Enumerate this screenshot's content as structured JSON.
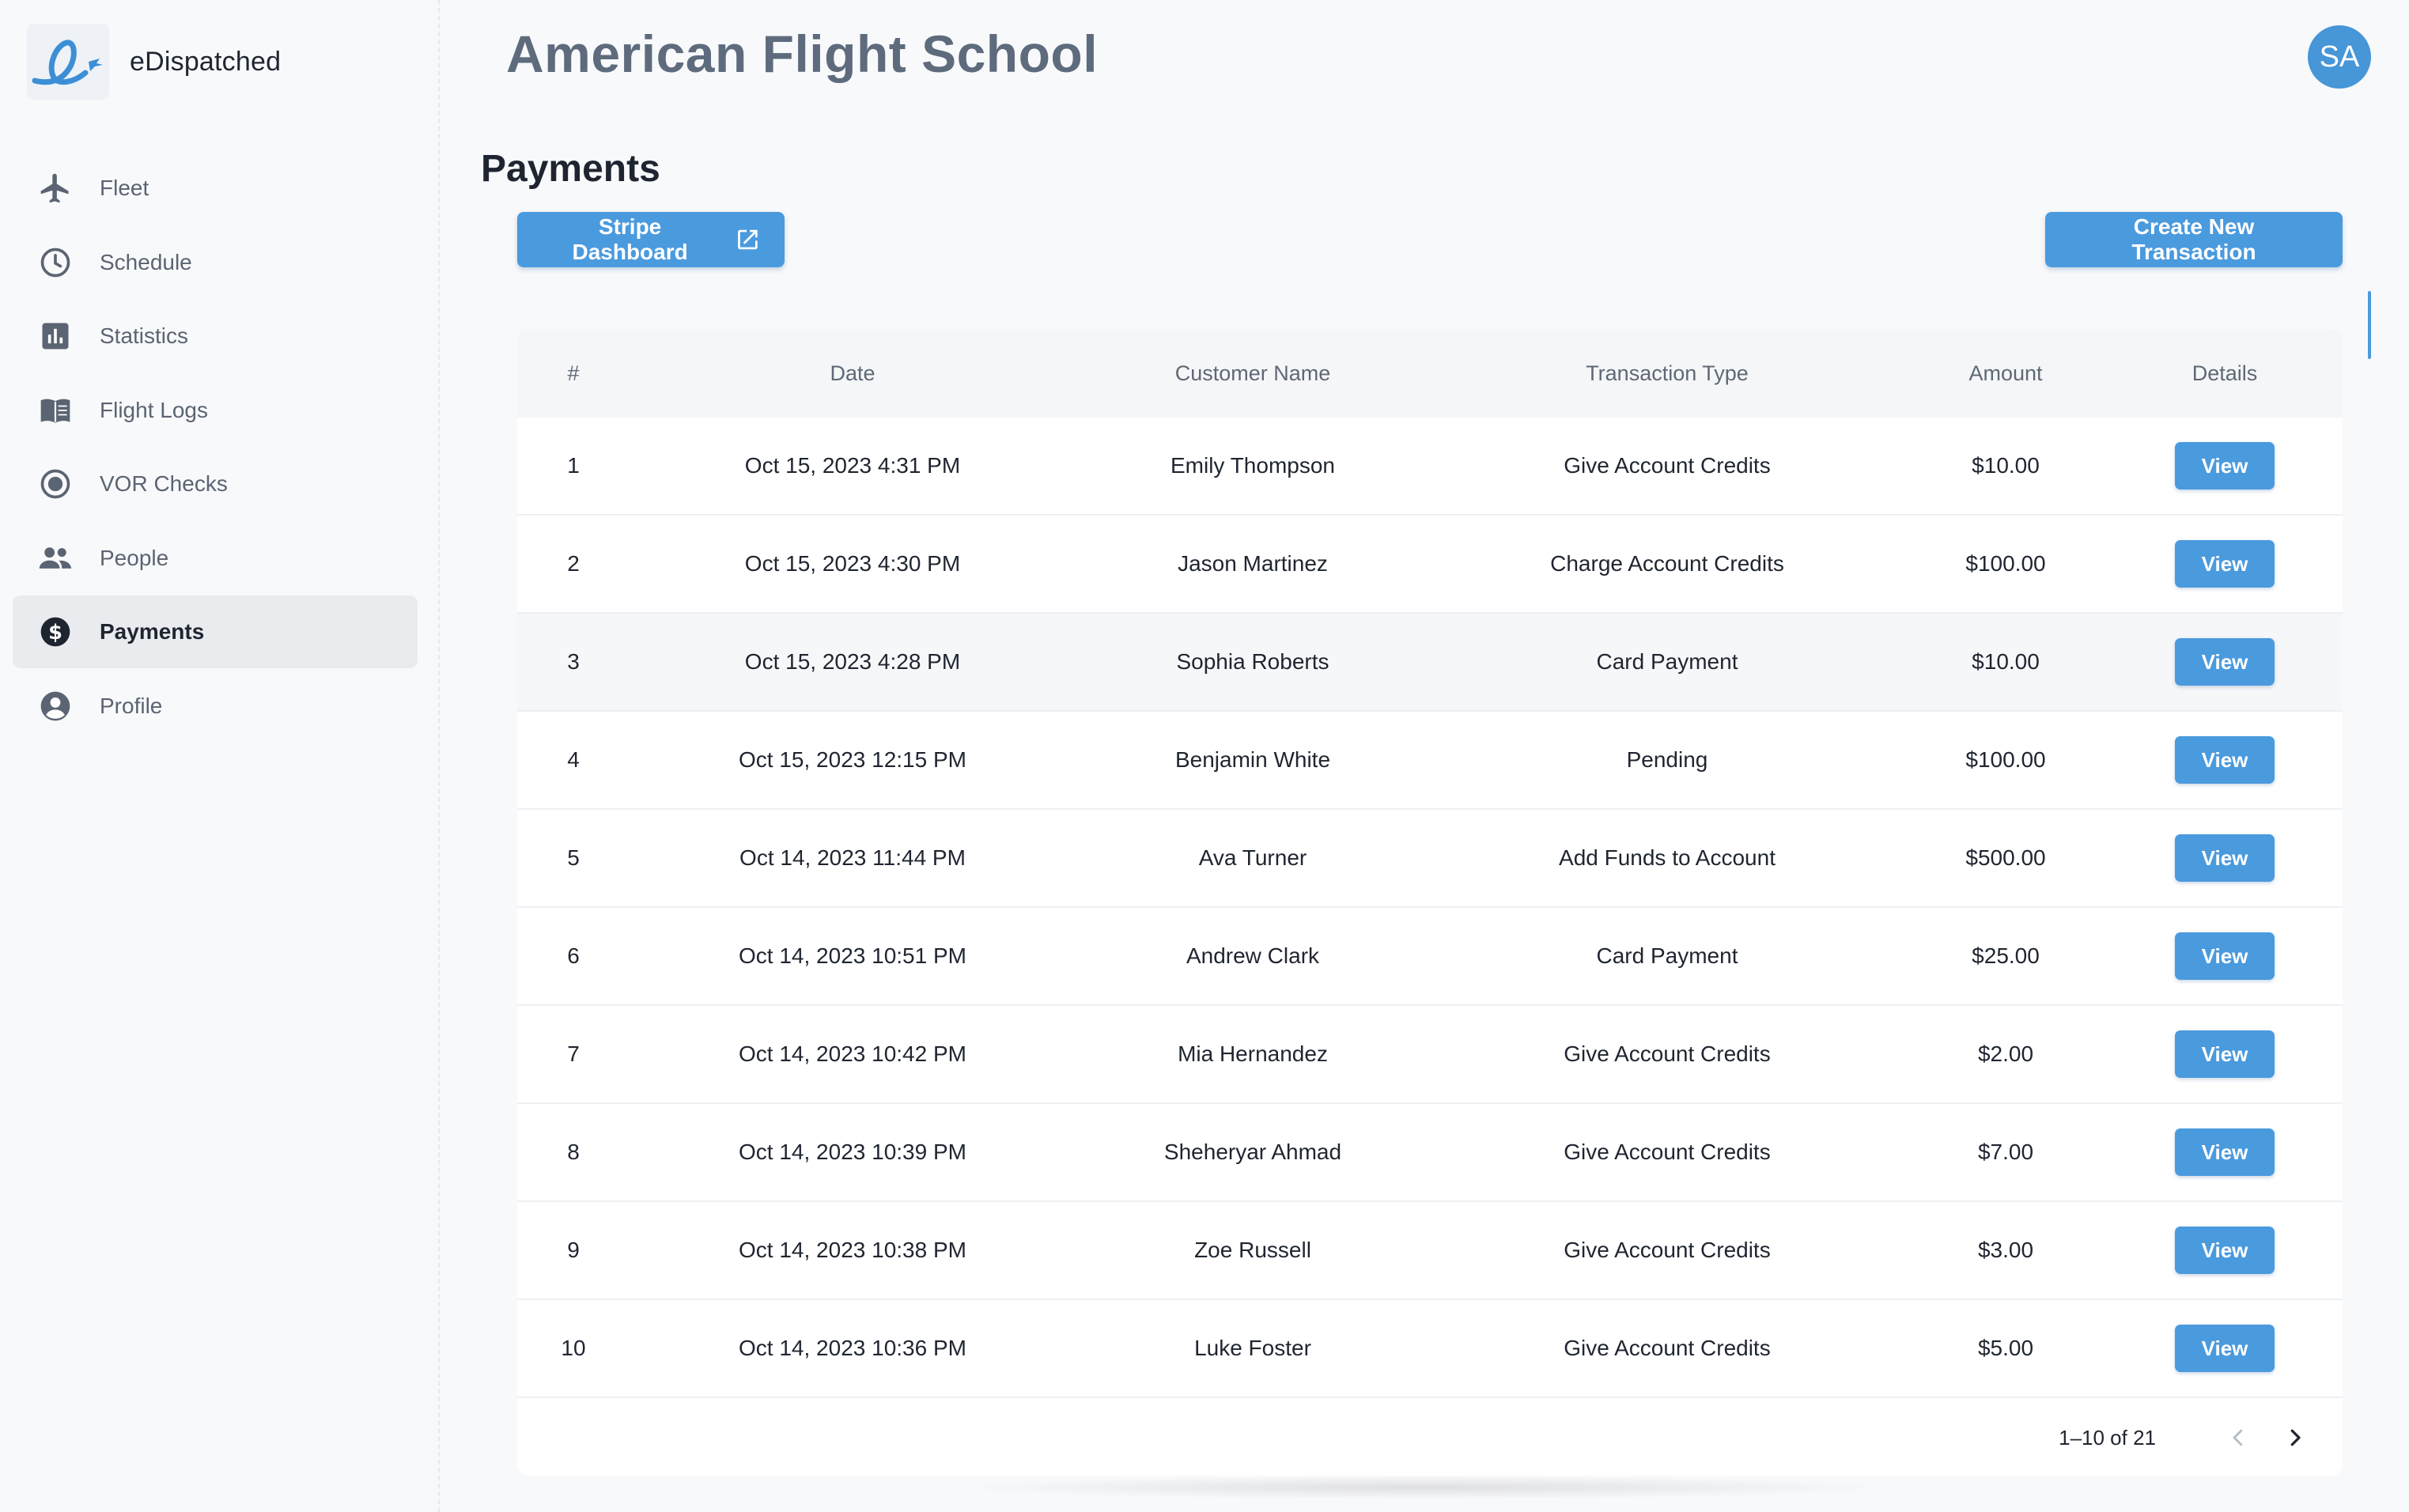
{
  "app": {
    "brand_name": "eDispatched",
    "school_name": "American Flight School",
    "user_initials": "SA",
    "accent_color": "#4a9ade"
  },
  "sidebar": {
    "items": [
      {
        "label": "Fleet",
        "icon": "airplane-icon",
        "active": false
      },
      {
        "label": "Schedule",
        "icon": "clock-icon",
        "active": false
      },
      {
        "label": "Statistics",
        "icon": "bar-chart-icon",
        "active": false
      },
      {
        "label": "Flight Logs",
        "icon": "book-icon",
        "active": false
      },
      {
        "label": "VOR Checks",
        "icon": "radio-target-icon",
        "active": false
      },
      {
        "label": "People",
        "icon": "people-icon",
        "active": false
      },
      {
        "label": "Payments",
        "icon": "dollar-icon",
        "active": true
      },
      {
        "label": "Profile",
        "icon": "account-icon",
        "active": false
      }
    ]
  },
  "page": {
    "title": "Payments",
    "stripe_button": "Stripe Dashboard",
    "create_button": "Create New Transaction"
  },
  "table": {
    "headers": [
      "#",
      "Date",
      "Customer Name",
      "Transaction Type",
      "Amount",
      "Details"
    ],
    "view_label": "View",
    "rows": [
      {
        "num": "1",
        "date": "Oct 15, 2023 4:31 PM",
        "customer": "Emily Thompson",
        "type": "Give Account Credits",
        "amount": "$10.00"
      },
      {
        "num": "2",
        "date": "Oct 15, 2023 4:30 PM",
        "customer": "Jason Martinez",
        "type": "Charge Account Credits",
        "amount": "$100.00"
      },
      {
        "num": "3",
        "date": "Oct 15, 2023 4:28 PM",
        "customer": "Sophia Roberts",
        "type": "Card Payment",
        "amount": "$10.00"
      },
      {
        "num": "4",
        "date": "Oct 15, 2023 12:15 PM",
        "customer": "Benjamin White",
        "type": "Pending",
        "amount": "$100.00"
      },
      {
        "num": "5",
        "date": "Oct 14, 2023 11:44 PM",
        "customer": "Ava Turner",
        "type": "Add Funds to Account",
        "amount": "$500.00"
      },
      {
        "num": "6",
        "date": "Oct 14, 2023 10:51 PM",
        "customer": "Andrew Clark",
        "type": "Card Payment",
        "amount": "$25.00"
      },
      {
        "num": "7",
        "date": "Oct 14, 2023 10:42 PM",
        "customer": "Mia Hernandez",
        "type": "Give Account Credits",
        "amount": "$2.00"
      },
      {
        "num": "8",
        "date": "Oct 14, 2023 10:39 PM",
        "customer": "Sheheryar Ahmad",
        "type": "Give Account Credits",
        "amount": "$7.00"
      },
      {
        "num": "9",
        "date": "Oct 14, 2023 10:38 PM",
        "customer": "Zoe Russell",
        "type": "Give Account Credits",
        "amount": "$3.00"
      },
      {
        "num": "10",
        "date": "Oct 14, 2023 10:36 PM",
        "customer": "Luke Foster",
        "type": "Give Account Credits",
        "amount": "$5.00"
      }
    ],
    "pagination": "1–10 of 21"
  }
}
